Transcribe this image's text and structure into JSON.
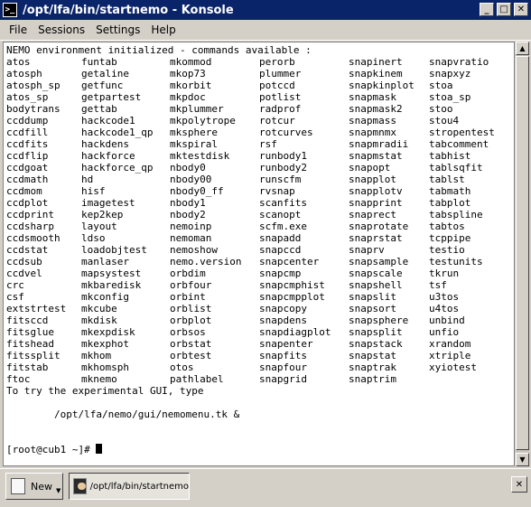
{
  "window": {
    "title": "/opt/lfa/bin/startnemo - Konsole",
    "app_icon": ">_",
    "buttons": {
      "minimize": "_",
      "maximize": "□",
      "close": "✕"
    }
  },
  "menu": [
    "File",
    "Sessions",
    "Settings",
    "Help"
  ],
  "terminal": {
    "header": "NEMO environment initialized - commands available :",
    "columns": [
      [
        "atos",
        "atosph",
        "atosph_sp",
        "atos_sp",
        "bodytrans",
        "ccddump",
        "ccdfill",
        "ccdfits",
        "ccdflip",
        "ccdgoat",
        "ccdmath",
        "ccdmom",
        "ccdplot",
        "ccdprint",
        "ccdsharp",
        "ccdsmooth",
        "ccdstat",
        "ccdsub",
        "ccdvel",
        "crc",
        "csf",
        "extstrtest",
        "fitsccd",
        "fitsglue",
        "fitshead",
        "fitssplit",
        "fitstab",
        "ftoc"
      ],
      [
        "funtab",
        "getaline",
        "getfunc",
        "getpartest",
        "gettab",
        "hackcode1",
        "hackcode1_qp",
        "hackdens",
        "hackforce",
        "hackforce_qp",
        "hd",
        "hisf",
        "imagetest",
        "kep2kep",
        "layout",
        "ldso",
        "loadobjtest",
        "manlaser",
        "mapsystest",
        "mkbaredisk",
        "mkconfig",
        "mkcube",
        "mkdisk",
        "mkexpdisk",
        "mkexphot",
        "mkhom",
        "mkhomsph",
        "mknemo"
      ],
      [
        "mkommod",
        "mkop73",
        "mkorbit",
        "mkpdoc",
        "mkplummer",
        "mkpolytrope",
        "mksphere",
        "mkspiral",
        "mktestdisk",
        "nbody0",
        "nbody00",
        "nbody0_ff",
        "nbody1",
        "nbody2",
        "nemoinp",
        "nemoman",
        "nemoshow",
        "nemo.version",
        "orbdim",
        "orbfour",
        "orbint",
        "orblist",
        "orbplot",
        "orbsos",
        "orbstat",
        "orbtest",
        "otos",
        "pathlabel"
      ],
      [
        "perorb",
        "plummer",
        "potccd",
        "potlist",
        "radprof",
        "rotcur",
        "rotcurves",
        "rsf",
        "runbody1",
        "runbody2",
        "runscfm",
        "rvsnap",
        "scanfits",
        "scanopt",
        "scfm.exe",
        "snapadd",
        "snapccd",
        "snapcenter",
        "snapcmp",
        "snapcmphist",
        "snapcmpplot",
        "snapcopy",
        "snapdens",
        "snapdiagplot",
        "snapenter",
        "snapfits",
        "snapfour",
        "snapgrid"
      ],
      [
        "snapinert",
        "snapkinem",
        "snapkinplot",
        "snapmask",
        "snapmask2",
        "snapmass",
        "snapmnmx",
        "snapmradii",
        "snapmstat",
        "snapopt",
        "snapplot",
        "snapplotv",
        "snapprint",
        "snaprect",
        "snaprotate",
        "snaprstat",
        "snaprv",
        "snapsample",
        "snapscale",
        "snapshell",
        "snapslit",
        "snapsort",
        "snapsphere",
        "snapsplit",
        "snapstack",
        "snapstat",
        "snaptrak",
        "snaptrim"
      ],
      [
        "snapvratio",
        "snapxyz",
        "stoa",
        "stoa_sp",
        "stoo",
        "stou4",
        "stropentest",
        "tabcomment",
        "tabhist",
        "tablsqfit",
        "tablst",
        "tabmath",
        "tabplot",
        "tabspline",
        "tabtos",
        "tcppipe",
        "testio",
        "testunits",
        "tkrun",
        "tsf",
        "u3tos",
        "u4tos",
        "unbind",
        "unfio",
        "xrandom",
        "xtriple",
        "xyiotest",
        ""
      ]
    ],
    "gui_hint": "To try the experimental GUI, type",
    "gui_command": "        /opt/lfa/nemo/gui/nemomenu.tk &",
    "prompt": "[root@cub1 ~]# "
  },
  "scrollbar": {
    "up": "▲",
    "down": "▼"
  },
  "taskbar": {
    "new_label": "New",
    "new_dropdown": "▼",
    "session_label": "/opt/lfa/bin/startnemo",
    "close": "✕"
  }
}
